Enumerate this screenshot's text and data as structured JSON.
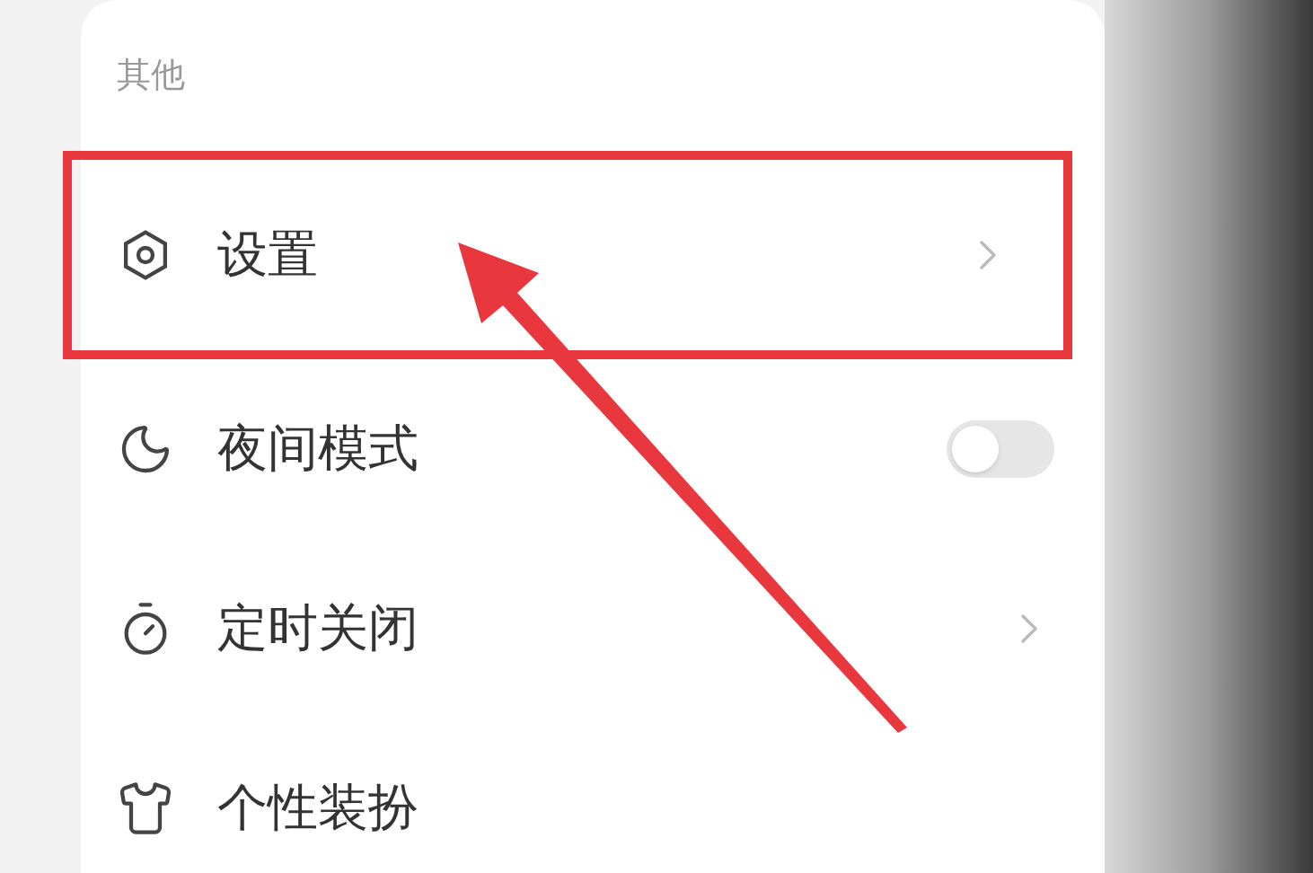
{
  "section": {
    "title": "其他"
  },
  "items": [
    {
      "kind": "link",
      "label": "设置",
      "highlighted": true
    },
    {
      "kind": "toggle",
      "label": "夜间模式",
      "on": false,
      "highlighted": false
    },
    {
      "kind": "link",
      "label": "定时关闭",
      "highlighted": false
    },
    {
      "kind": "plain",
      "label": "个性装扮",
      "highlighted": false
    }
  ]
}
